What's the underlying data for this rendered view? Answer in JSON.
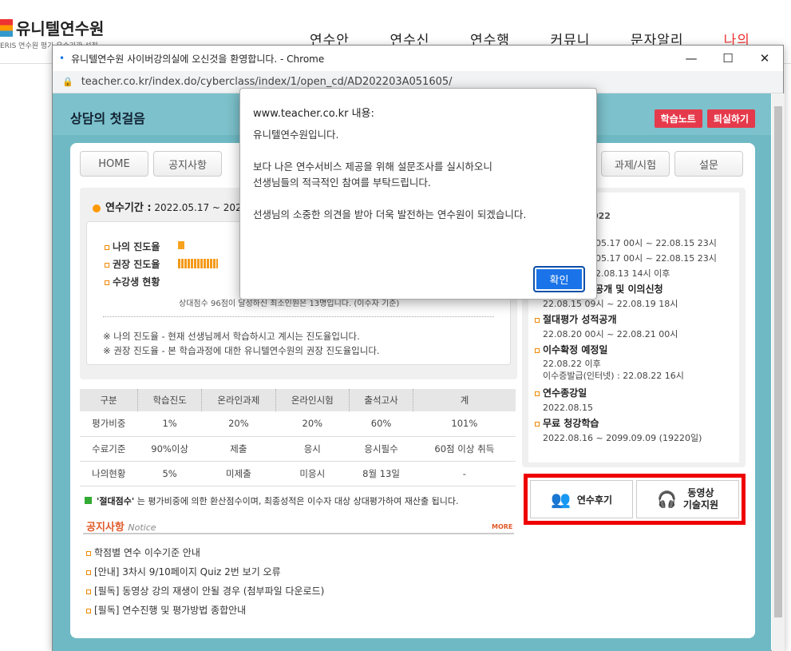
{
  "site": {
    "logo": "유니텔연수원",
    "sub": "ERIS 연수원 평가 우수기관 선정",
    "nav": [
      "연수안내",
      "연수신청",
      "연수행정",
      "커뮤니티",
      "문자알리미",
      "나의강"
    ]
  },
  "window": {
    "title": "유니텔연수원 사이버강의실에 오신것을 환영합니다. - Chrome",
    "url": "teacher.co.kr/index.do/cyberclass/index/1/open_cd/AD202203A051605/"
  },
  "page": {
    "title": "상담의 첫걸음",
    "buttons": {
      "note": "학습노트",
      "exit": "퇴실하기"
    },
    "tabs": [
      "HOME",
      "공지사항"
    ],
    "tabs_right": [
      "과제/시험",
      "설문"
    ],
    "period_label": "연수기간 :",
    "period_value": "2022.05.17 ~ 2022",
    "progress": {
      "mine": "나의 진도율",
      "rec": "권장 진도율",
      "status": "수강생 현황",
      "rank": "상대점수 96점이 달성하신 최소인원은 13명입니다. (이수자 기준)",
      "note1": "※ 나의 진도율 - 현재 선생님께서 학습하시고 계시는 진도율입니다.",
      "note2": "※ 권장 진도율 - 본 학습과정에 대한 유니텔연수원의 권장 진도율입니다."
    },
    "table": {
      "headers": [
        "구분",
        "학습진도",
        "온라인과제",
        "온라인시험",
        "출석고사",
        "계"
      ],
      "rows": [
        [
          "평가비중",
          "1%",
          "20%",
          "20%",
          "60%",
          "101%"
        ],
        [
          "수료기준",
          "90%이상",
          "제출",
          "응시",
          "응시필수",
          "60점 이상 취득"
        ],
        [
          "나의현황",
          "5%",
          "미제출",
          "미응시",
          "8월 13일",
          "-"
        ]
      ]
    },
    "abs_note_bold": "'절대점수'",
    "abs_note": "는 평가비중에 의한 환산점수이며, 최종성적은 이수자 대상 상대평가하여 재산출 됩니다.",
    "notice": {
      "title": "공지사항",
      "sub": "Notice",
      "more": "MORE",
      "items": [
        "학점별 연수 이수기준 안내",
        "[안내] 3차시 9/10페이지 Quiz 2번 보기 오류",
        "[필독] 동영상 강의 재생이 안될 경우 (첨부파일 다운로드)",
        "[필독] 연수진행 및 평가방법 종합안내"
      ]
    },
    "schedule": {
      "year": "022",
      "l1": "05.17 00시 ~ 22.08.15 23시",
      "l2": "05.17 00시 ~ 22.08.15 23시",
      "l3": "2.08.13 14시 이후",
      "h4": "답공개 및 이의신청",
      "l4": "22.08.15 09시 ~ 22.08.19 18시",
      "h5": "절대평가 성적공개",
      "l5": "22.08.20 00시 ~ 22.08.21 00시",
      "h6": "이수확정 예정일",
      "l6a": "22.08.22 이후",
      "l6b": "이수증발급(인터넷) : 22.08.22 16시",
      "h7": "연수종강일",
      "l7": "2022.08.15",
      "h8": "무료 청강학습",
      "l8": "2022.08.16 ~ 2099.09.09 (19220일)"
    },
    "quick": {
      "review": "연수후기",
      "support1": "동영상",
      "support2": "기술지원"
    }
  },
  "dialog": {
    "title": "www.teacher.co.kr 내용:",
    "message": "유니텔연수원입니다.\n\n보다 나은 연수서비스 제공을 위해 설문조사를 실시하오니\n선생님들의 적극적인 참여를 부탁드립니다.\n\n선생님의 소중한 의견을 받아 더욱 발전하는 연수원이 되겠습니다.",
    "ok": "확인"
  }
}
